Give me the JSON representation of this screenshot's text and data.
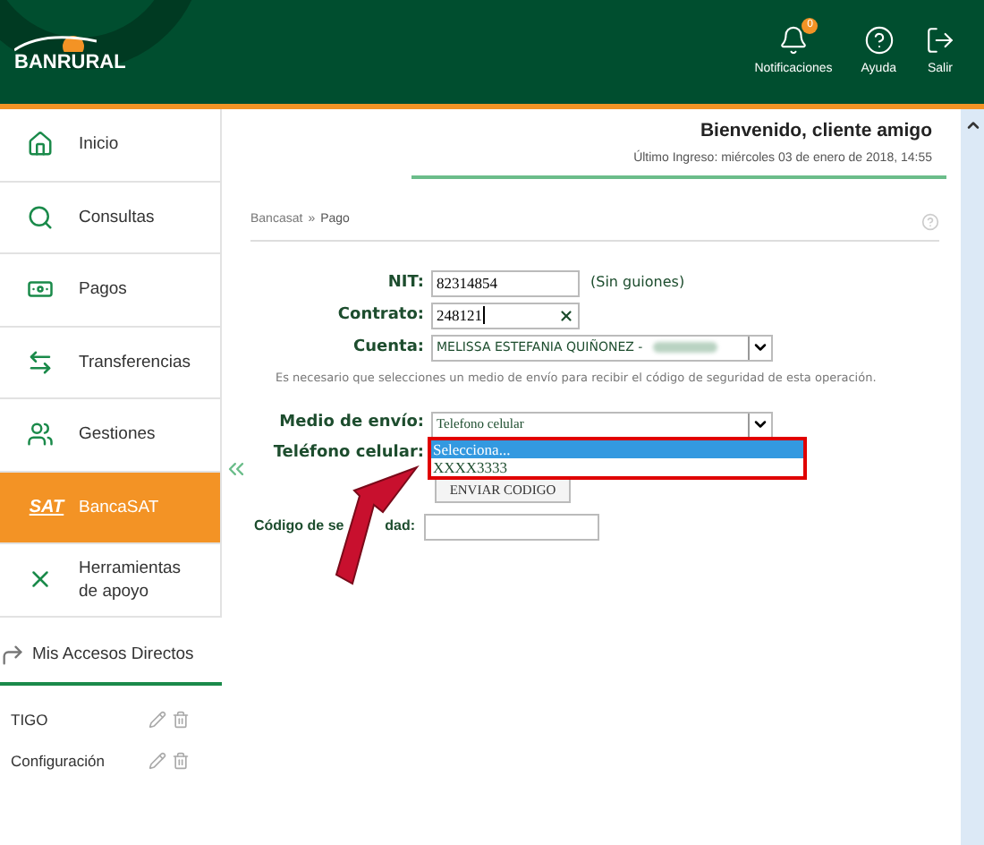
{
  "header": {
    "logo_text": "BANRURAL",
    "actions": [
      {
        "kind": "bell",
        "label": "Notificaciones",
        "badge": "0"
      },
      {
        "kind": "help",
        "label": "Ayuda"
      },
      {
        "kind": "exit",
        "label": "Salir"
      }
    ]
  },
  "sidebar": {
    "items": [
      {
        "kind": "home",
        "label": "Inicio",
        "selected": false
      },
      {
        "kind": "search",
        "label": "Consultas",
        "selected": false
      },
      {
        "kind": "money",
        "label": "Pagos",
        "selected": false
      },
      {
        "kind": "transfer",
        "label": "Transferencias",
        "selected": false
      },
      {
        "kind": "people",
        "label": "Gestiones",
        "selected": false
      },
      {
        "kind": "sat",
        "label": "BancaSAT",
        "logo_text": "SAT",
        "selected": true
      },
      {
        "kind": "tools",
        "label": "Herramientas de apoyo",
        "selected": false
      }
    ],
    "shortcuts": {
      "title": "Mis Accesos Directos",
      "items": [
        {
          "label": "TIGO"
        },
        {
          "label": "Configuración"
        }
      ]
    }
  },
  "welcome": {
    "title": "Bienvenido, cliente amigo",
    "last_login": "Último Ingreso: miércoles 03 de enero de 2018, 14:55"
  },
  "breadcrumb": [
    "Bancasat",
    "»",
    "Pago"
  ],
  "form": {
    "nit": {
      "label": "NIT:",
      "value": "82314854",
      "hint": "(Sin guiones)"
    },
    "contrato": {
      "label": "Contrato:",
      "value": "248121"
    },
    "cuenta": {
      "label": "Cuenta:",
      "value": "MELISSA ESTEFANIA QUIÑONEZ -"
    },
    "note": "Es necesario que selecciones un medio de envío para recibir el código de seguridad de esta operación.",
    "medio": {
      "label": "Medio de envío:",
      "value": "Telefono celular"
    },
    "telefono": {
      "label": "Teléfono celular:",
      "options": [
        {
          "label": "Selecciona...",
          "selected": true
        },
        {
          "label": "XXXX3333",
          "selected": false
        }
      ]
    },
    "send_button": "ENVIAR CODIGO",
    "codigo": {
      "label_start": "Código de se",
      "label_end": "dad:"
    }
  }
}
